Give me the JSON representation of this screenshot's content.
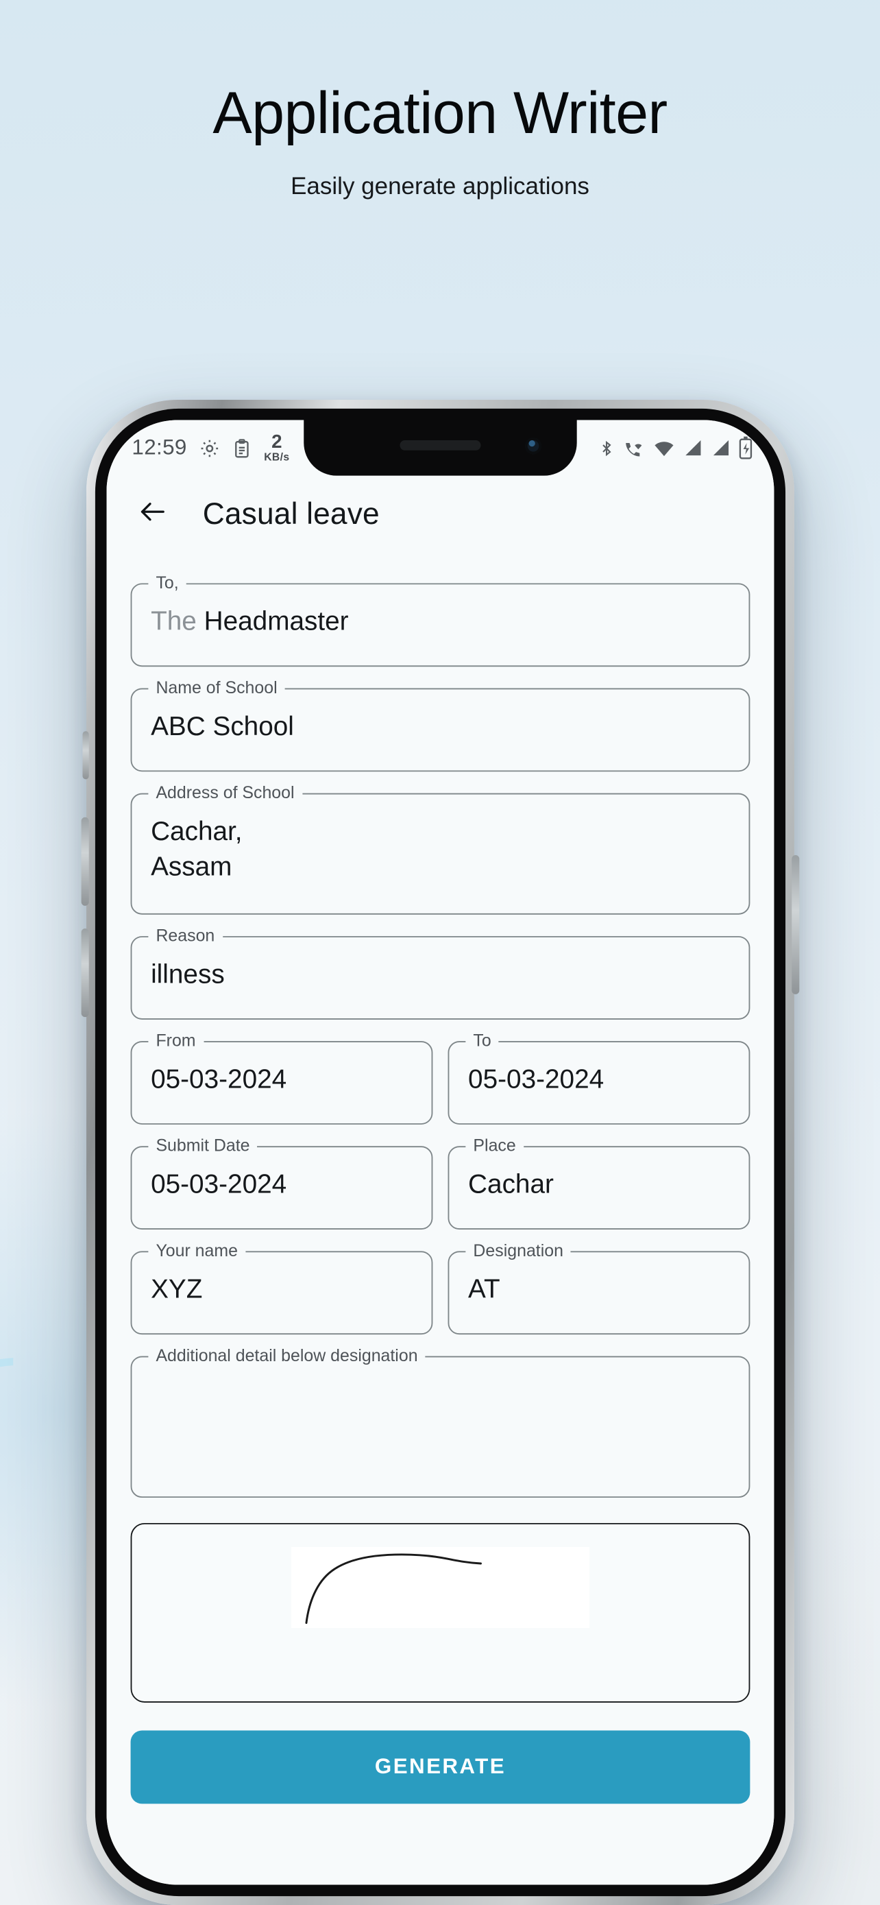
{
  "hero": {
    "title": "Application Writer",
    "subtitle": "Easily generate applications"
  },
  "phone": {
    "statusbar": {
      "clock": "12:59",
      "icons_left": [
        "gear-icon",
        "clipboard-icon"
      ],
      "network_speed_value": "2",
      "network_speed_unit": "KB/s",
      "icons_right": [
        "bluetooth-icon",
        "vowifi-call-icon",
        "wifi-icon",
        "signal-sim1-icon",
        "signal-sim2-icon",
        "battery-charging-icon"
      ]
    },
    "appbar": {
      "back_icon": "arrow-left-icon",
      "title": "Casual leave"
    },
    "form": {
      "fields": [
        {
          "label": "To,",
          "hint": "The ",
          "value": "Headmaster"
        },
        {
          "label": "Name of School",
          "value": "ABC School"
        },
        {
          "label": "Address of School",
          "value": "Cachar,\nAssam"
        },
        {
          "label": "Reason",
          "value": "illness"
        },
        {
          "label": "From",
          "value": "05-03-2024"
        },
        {
          "label": "To",
          "value": "05-03-2024"
        },
        {
          "label": "Submit Date",
          "value": "05-03-2024"
        },
        {
          "label": "Place",
          "value": "Cachar"
        },
        {
          "label": "Your name",
          "value": "XYZ"
        },
        {
          "label": "Designation",
          "value": "AT"
        },
        {
          "label": "Additional detail below designation",
          "value": ""
        }
      ],
      "signature_pad": {
        "name": "signature-pad",
        "has_drawing": true
      },
      "generate_button": "GENERATE"
    }
  },
  "colors": {
    "accent": "#2a9cc0",
    "field_border": "#7e8689",
    "screen_bg": "#f7fafb",
    "page_bg_top": "#d7e8f2",
    "deco_arc": "#bfe4f3"
  }
}
